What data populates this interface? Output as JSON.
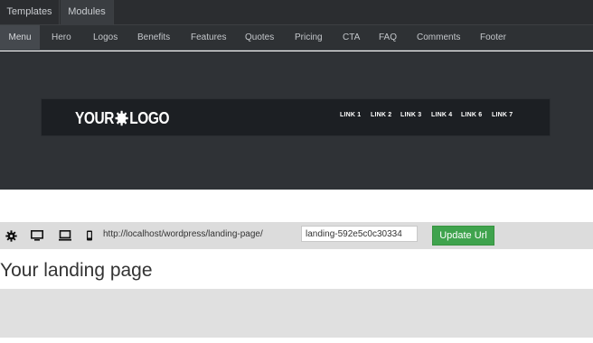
{
  "top_tabs": [
    "Templates",
    "Modules"
  ],
  "sub_tabs": [
    "Menu",
    "Hero",
    "Logos",
    "Benefits",
    "Features",
    "Quotes",
    "Pricing",
    "CTA",
    "FAQ",
    "Comments",
    "Footer"
  ],
  "preview": {
    "logo_left": "YOUR",
    "logo_right": "LOGO",
    "nav_links": [
      "LINK 1",
      "LINK 2",
      "LINK 3",
      "LINK 4",
      "LINK 6",
      "LINK 7"
    ]
  },
  "url_bar": {
    "icons": [
      "gear-icon",
      "desktop-icon",
      "laptop-icon",
      "mobile-icon"
    ],
    "base_url": "http://localhost/wordpress/landing-page/",
    "slug_value": "landing-592e5c0c30334",
    "update_label": "Update Url"
  },
  "page": {
    "heading": "Your landing page"
  },
  "colors": {
    "dark_bg": "#2b2d30",
    "preview_bg": "#2f3236",
    "navbar_bg": "#1c1f23",
    "button_green": "#3fa34d",
    "url_bar_bg": "#dcdcdc"
  }
}
